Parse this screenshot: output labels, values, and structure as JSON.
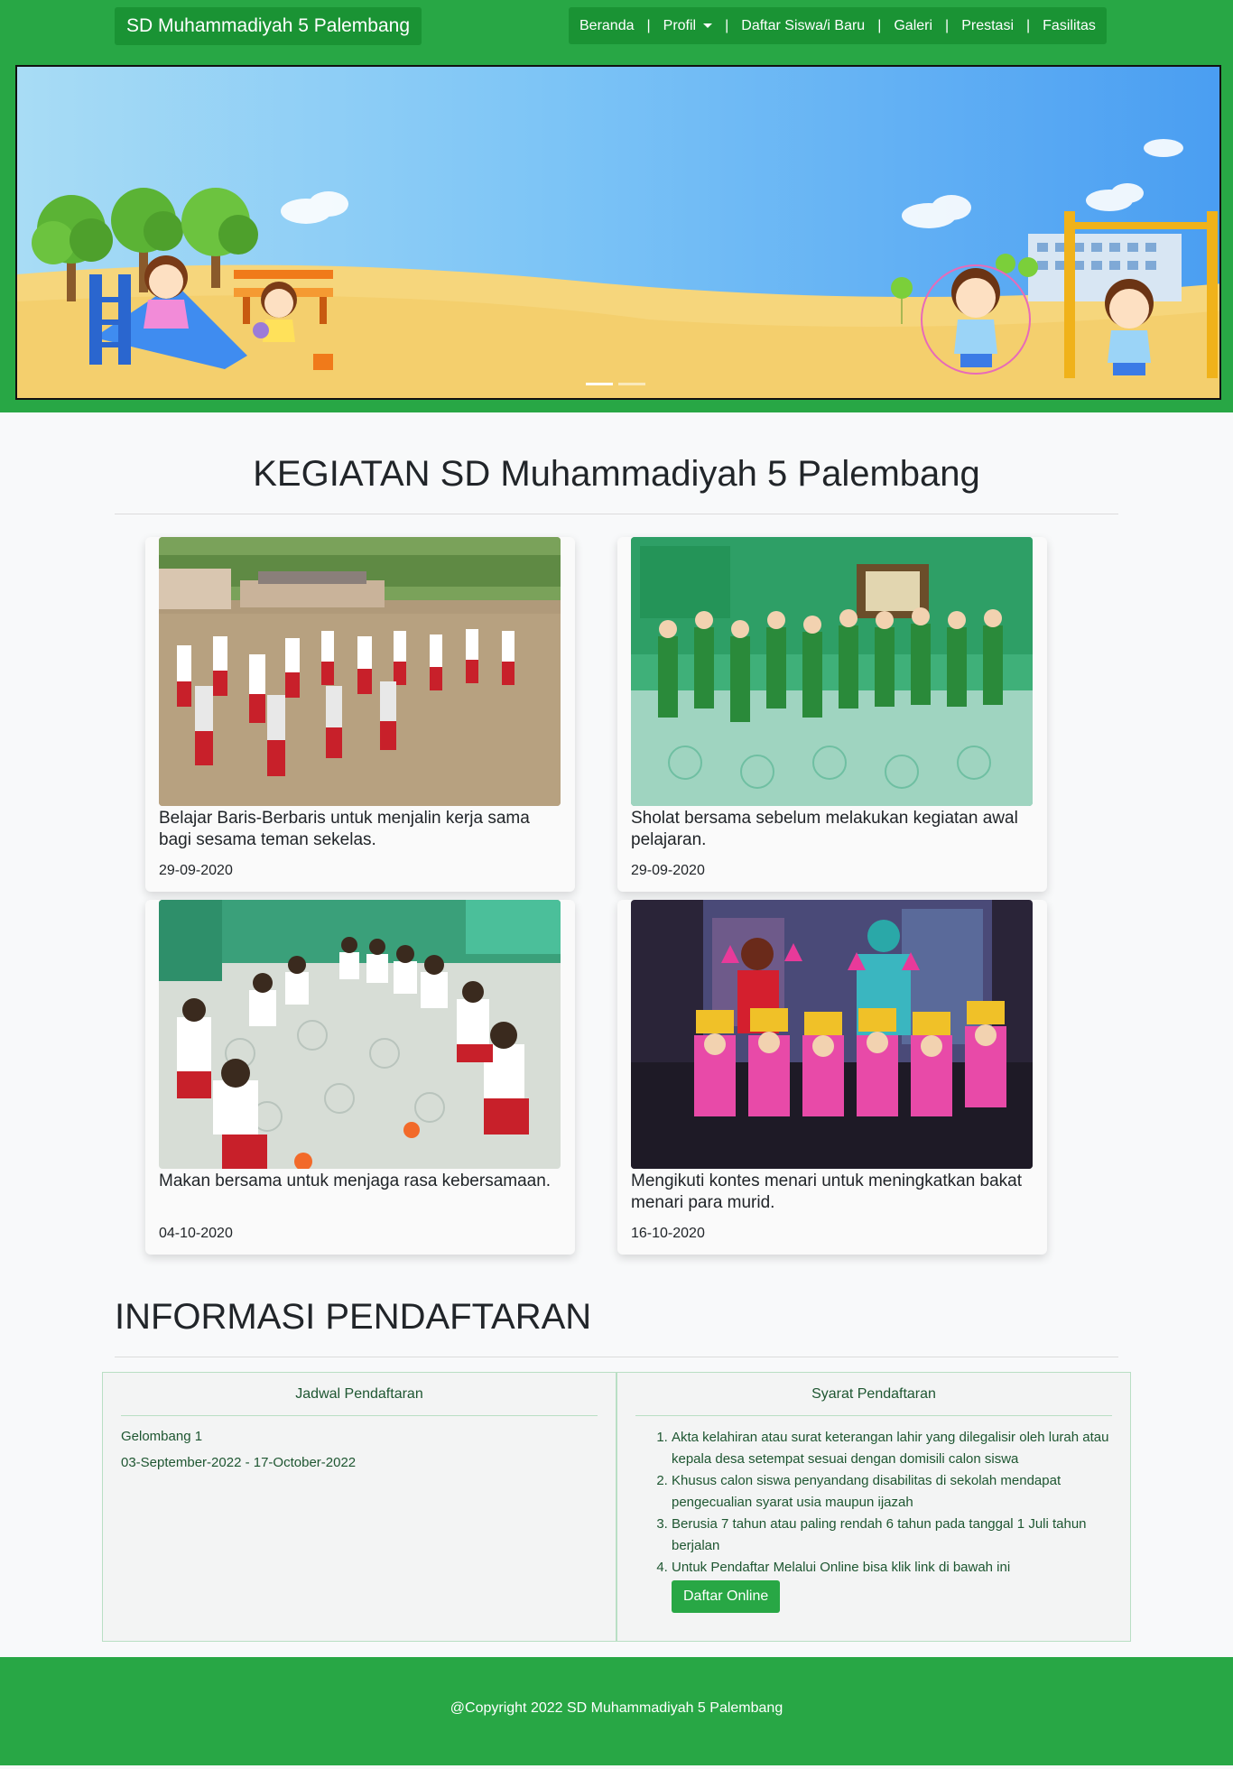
{
  "navbar": {
    "brand": "SD Muhammadiyah 5 Palembang",
    "items": [
      {
        "label": "Beranda"
      },
      {
        "label": "Profil"
      },
      {
        "label": "Daftar Siswa/i Baru"
      },
      {
        "label": "Galeri"
      },
      {
        "label": "Prestasi"
      },
      {
        "label": "Fasilitas"
      }
    ],
    "separator": "|"
  },
  "colors": {
    "primary_green": "#28a745",
    "dark_green": "#1a9334",
    "panel_text": "#1e5631"
  },
  "kegiatan": {
    "title": "KEGIATAN SD Muhammadiyah 5 Palembang",
    "cards": [
      {
        "caption": "Belajar Baris-Berbaris untuk menjalin kerja sama bagi sesama teman sekelas.",
        "date": "29-09-2020"
      },
      {
        "caption": "Sholat bersama sebelum melakukan kegiatan awal pelajaran.",
        "date": "29-09-2020"
      },
      {
        "caption": "Makan bersama untuk menjaga rasa kebersamaan.",
        "date": "04-10-2020"
      },
      {
        "caption": "Mengikuti kontes menari untuk meningkatkan bakat menari para murid.",
        "date": "16-10-2020"
      }
    ]
  },
  "informasi": {
    "title": "INFORMASI PENDAFTARAN",
    "jadwal": {
      "heading": "Jadwal Pendaftaran",
      "gelombang": "Gelombang 1",
      "periode": "03-September-2022 - 17-October-2022"
    },
    "syarat": {
      "heading": "Syarat Pendaftaran",
      "items": [
        "Akta kelahiran atau surat keterangan lahir yang dilegalisir oleh lurah atau kepala desa setempat sesuai dengan domisili calon siswa",
        "Khusus calon siswa penyandang disabilitas di sekolah mendapat pengecualian syarat usia maupun ijazah",
        "Berusia 7 tahun atau paling rendah 6 tahun pada tanggal 1 Juli tahun berjalan",
        "Untuk Pendaftar Melalui Online bisa klik link di bawah ini"
      ],
      "button": "Daftar Online"
    }
  },
  "carousel": {
    "slide_count": 2,
    "active_slide": 1
  },
  "footer": {
    "copyright": "@Copyright 2022 SD Muhammadiyah 5 Palembang"
  }
}
